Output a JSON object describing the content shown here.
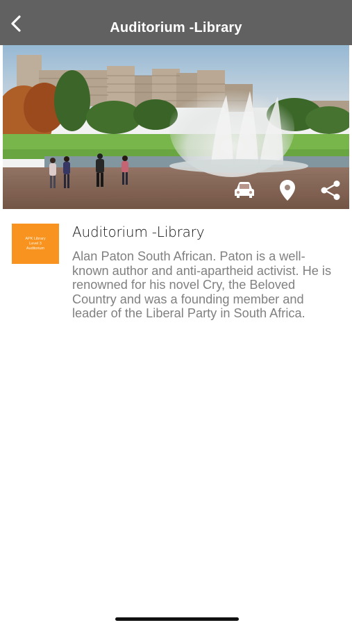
{
  "header": {
    "title": "Auditorium -Library",
    "back_icon": "chevron-left-icon"
  },
  "hero": {
    "image_desc": "campus-fountain-photo",
    "actions": [
      {
        "name": "car-icon"
      },
      {
        "name": "location-pin-icon"
      },
      {
        "name": "share-icon"
      }
    ]
  },
  "place": {
    "thumbnail_lines": [
      "APK Library",
      "Level 3",
      "Auditorium"
    ],
    "title": "Auditorium -Library",
    "description": "Alan Paton South African. Paton is a well- known author and anti-apartheid activist. He is renowned for his novel Cry, the Beloved Country and was a founding member and leader of the Liberal Party in South Africa."
  },
  "colors": {
    "header_bg": "#616161",
    "thumbnail_bg": "#f7931e",
    "description_text": "#808080"
  }
}
